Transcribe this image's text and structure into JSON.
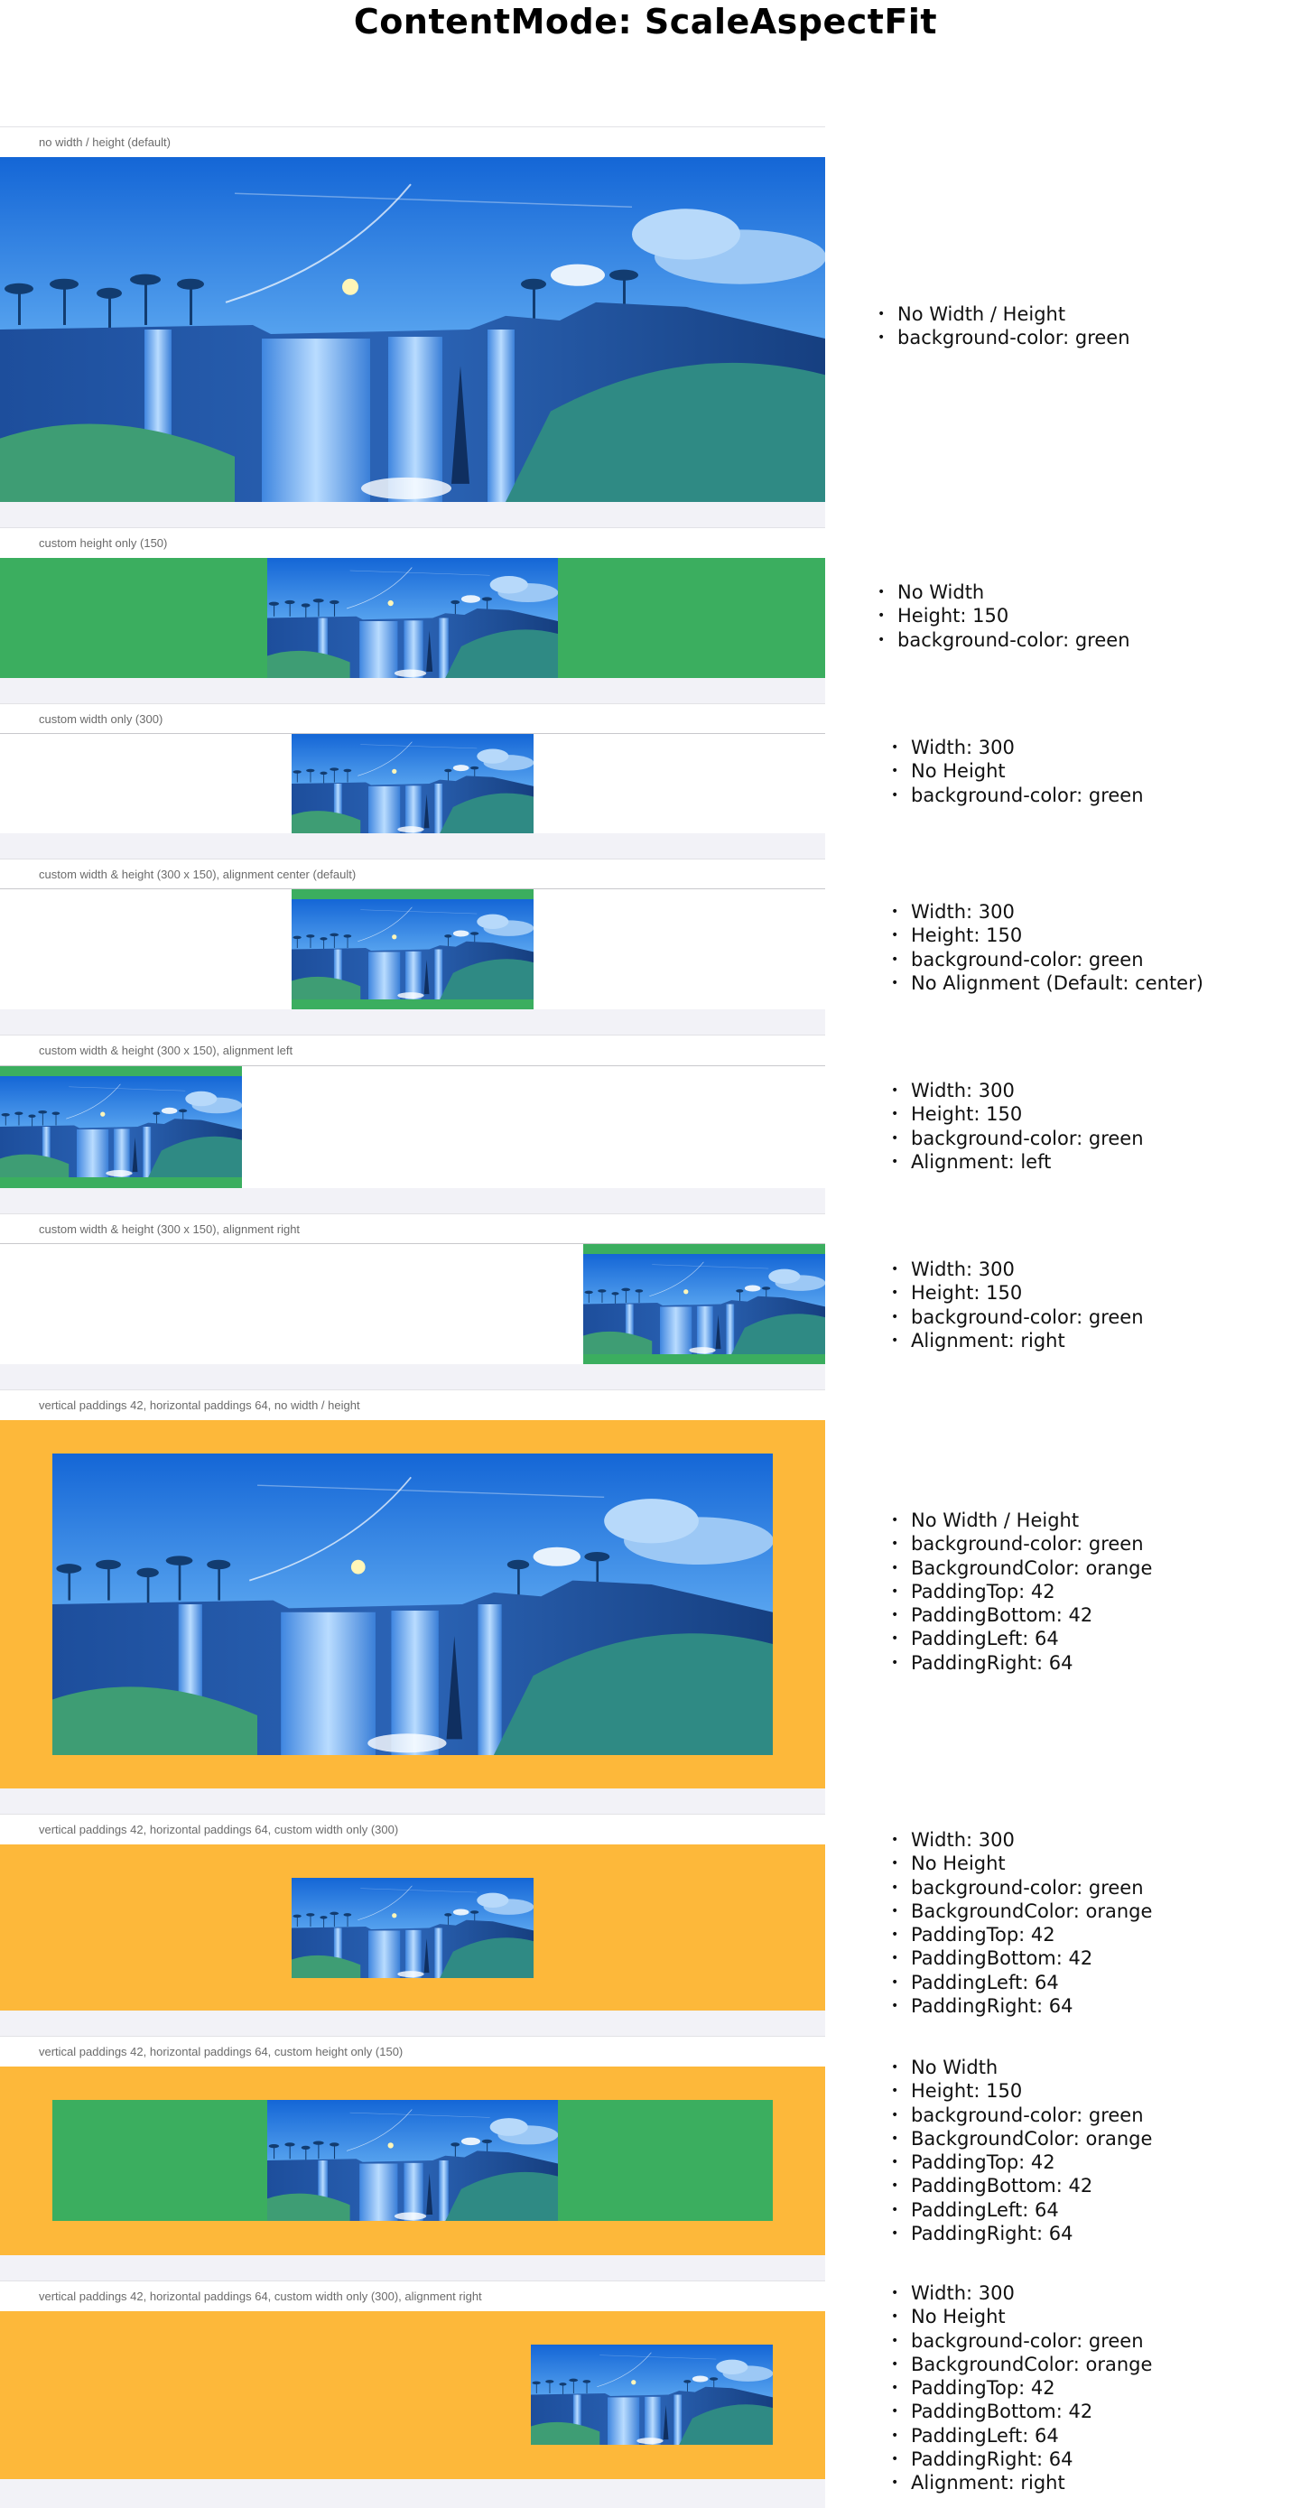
{
  "title": "ContentMode: ScaleAspectFit",
  "colors": {
    "green": "#3bae5f",
    "orange": "#fdb83a",
    "white": "#ffffff",
    "separator": "#f2f2f7"
  },
  "image": {
    "name": "waterfall-illustration"
  },
  "sections": [
    {
      "label": "no width / height (default)",
      "notes": [
        "No Width / Height",
        "background-color: green"
      ]
    },
    {
      "label": "custom height only (150)",
      "notes": [
        "No Width",
        "Height: 150",
        "background-color: green"
      ]
    },
    {
      "label": "custom width only (300)",
      "notes": [
        "Width: 300",
        "No Height",
        "background-color: green"
      ]
    },
    {
      "label": "custom width & height (300 x 150), alignment center (default)",
      "notes": [
        "Width: 300",
        "Height: 150",
        "background-color: green",
        "No Alignment (Default: center)"
      ]
    },
    {
      "label": "custom width & height (300 x 150), alignment left",
      "notes": [
        "Width: 300",
        "Height: 150",
        "background-color: green",
        "Alignment: left"
      ]
    },
    {
      "label": "custom width & height (300 x 150), alignment right",
      "notes": [
        "Width: 300",
        "Height: 150",
        "background-color: green",
        "Alignment: right"
      ]
    },
    {
      "label": "vertical paddings 42, horizontal paddings 64, no width / height",
      "notes": [
        "No Width / Height",
        "background-color: green",
        "BackgroundColor: orange",
        "PaddingTop: 42",
        "PaddingBottom: 42",
        "PaddingLeft: 64",
        "PaddingRight: 64"
      ]
    },
    {
      "label": "vertical paddings 42, horizontal paddings 64, custom width only (300)",
      "notes": [
        "Width: 300",
        "No Height",
        "background-color: green",
        "BackgroundColor: orange",
        "PaddingTop: 42",
        "PaddingBottom: 42",
        "PaddingLeft: 64",
        "PaddingRight: 64"
      ]
    },
    {
      "label": "vertical paddings 42, horizontal paddings 64, custom height only (150)",
      "notes": [
        "No Width",
        "Height: 150",
        "background-color: green",
        "BackgroundColor: orange",
        "PaddingTop: 42",
        "PaddingBottom: 42",
        "PaddingLeft: 64",
        "PaddingRight: 64"
      ]
    },
    {
      "label": "vertical paddings 42, horizontal paddings 64, custom width only (300), alignment right",
      "notes": [
        "Width: 300",
        "No Height",
        "background-color: green",
        "BackgroundColor: orange",
        "PaddingTop: 42",
        "PaddingBottom: 42",
        "PaddingLeft: 64",
        "PaddingRight: 64",
        "Alignment: right"
      ]
    }
  ]
}
